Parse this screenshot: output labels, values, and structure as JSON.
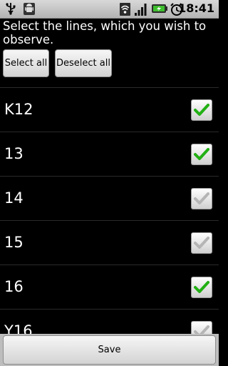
{
  "status_bar": {
    "time": "18:41",
    "icons": [
      "usb-icon",
      "android-debug-icon",
      "wifi-icon",
      "signal-icon",
      "battery-charging-icon",
      "alarm-icon"
    ]
  },
  "instruction": "Select the lines, which you wish to observe.",
  "buttons": {
    "select_all": "Select all",
    "deselect_all": "Deselect all",
    "save": "Save"
  },
  "lines": [
    {
      "label": "K12",
      "checked": true
    },
    {
      "label": "13",
      "checked": true
    },
    {
      "label": "14",
      "checked": false
    },
    {
      "label": "15",
      "checked": false
    },
    {
      "label": "16",
      "checked": true
    },
    {
      "label": "Y16",
      "checked": false
    }
  ],
  "colors": {
    "check_green": "#22b014",
    "check_gray": "#b5b5b5"
  }
}
